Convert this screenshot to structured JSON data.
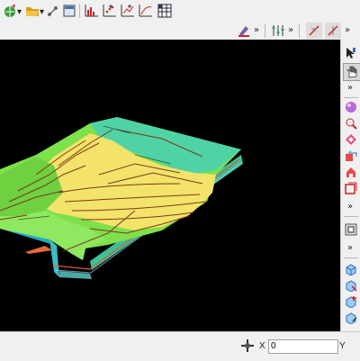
{
  "toolbar": {
    "more_glyph": "»"
  },
  "statusbar": {
    "x_label": "X",
    "x_value": "0",
    "y_label": "Y"
  },
  "icons": {
    "toolbar1": [
      "globe-pen-icon",
      "open-folder-icon",
      "move-points-icon",
      "layout-icon",
      "histogram-icon",
      "scatter-plot-icon",
      "line-plot-icon",
      "curve-plot-icon",
      "spreadsheet-icon"
    ],
    "toolbar2": [
      "paint-tool-icon",
      "properties-icon",
      "edit-line-icon",
      "split-line-icon"
    ],
    "right": [
      "pointer-icon",
      "pan-hand-icon",
      "rotate-sphere-icon",
      "zoom-icon",
      "fit-view-icon",
      "view-3d-icon",
      "box-view-icon",
      "frame-icon",
      "cube-edit-icon",
      "cube-select-icon",
      "cube-add-icon",
      "cube-remove-icon"
    ]
  },
  "colors": {
    "model_green": "#7ee04a",
    "model_yellow": "#f3e36a",
    "model_teal": "#4fd3a5",
    "fault_lines": "#7a3a1a",
    "background": "#000000"
  }
}
